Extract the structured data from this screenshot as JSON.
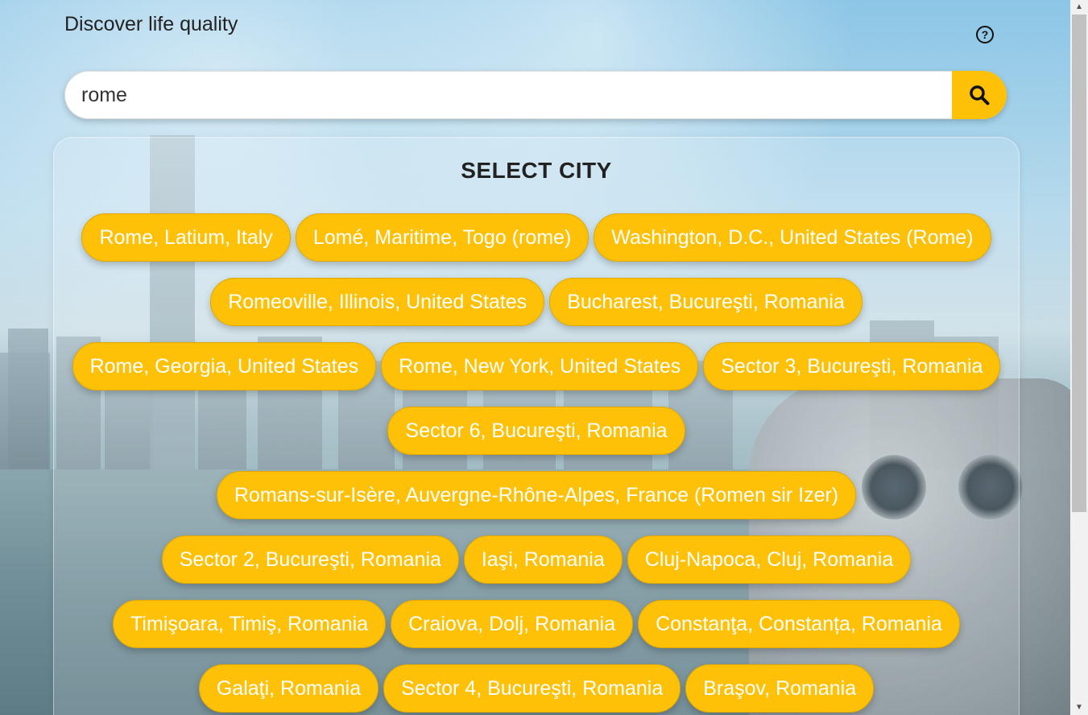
{
  "header": {
    "title": "Discover life quality",
    "help_icon": "question-circle-icon"
  },
  "search": {
    "value": "rome",
    "placeholder": "",
    "button_icon": "magnifier-icon"
  },
  "panel": {
    "title": "SELECT CITY",
    "cities": [
      "Rome, Latium, Italy",
      "Lomé, Maritime, Togo (rome)",
      "Washington, D.C., United States (Rome)",
      "Romeoville, Illinois, United States",
      "Bucharest, Bucureşti, Romania",
      "Rome, Georgia, United States",
      "Rome, New York, United States",
      "Sector 3, Bucureşti, Romania",
      "Sector 6, Bucureşti, Romania",
      "Romans-sur-Isère, Auvergne-Rhône-Alpes, France (Romen sir Izer)",
      "Sector 2, Bucureşti, Romania",
      "Iaşi, Romania",
      "Cluj-Napoca, Cluj, Romania",
      "Timişoara, Timiş, Romania",
      "Craiova, Dolj, Romania",
      "Constanţa, Constanța, Romania",
      "Galaţi, Romania",
      "Sector 4, Bucureşti, Romania",
      "Braşov, Romania"
    ]
  },
  "colors": {
    "accent": "#ffc107",
    "button_text": "#ffffff",
    "title_text": "#222222"
  }
}
